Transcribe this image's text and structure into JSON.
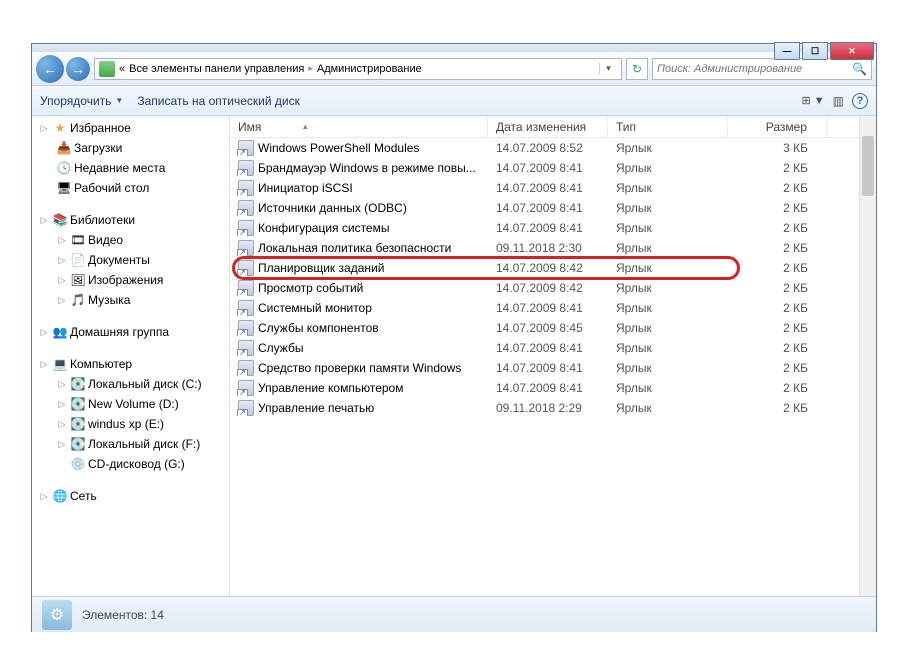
{
  "breadcrumb": {
    "prefix": "«",
    "parent": "Все элементы панели управления",
    "current": "Администрирование"
  },
  "search": {
    "placeholder": "Поиск: Администрирование"
  },
  "toolbar": {
    "organize": "Упорядочить",
    "burn": "Записать на оптический диск"
  },
  "sidebar": {
    "favorites": "Избранное",
    "downloads": "Загрузки",
    "recent": "Недавние места",
    "desktop": "Рабочий стол",
    "libraries": "Библиотеки",
    "videos": "Видео",
    "documents": "Документы",
    "pictures": "Изображения",
    "music": "Музыка",
    "homegroup": "Домашняя группа",
    "computer": "Компьютер",
    "disk_c": "Локальный диск (C:)",
    "disk_d": "New Volume (D:)",
    "disk_e": "windus xp (E:)",
    "disk_f": "Локальный диск (F:)",
    "cd": "CD-дисковод (G:)",
    "network": "Сеть"
  },
  "columns": {
    "name": "Имя",
    "date": "Дата изменения",
    "type": "Тип",
    "size": "Размер"
  },
  "type_label": "Ярлык",
  "files": [
    {
      "name": "Windows PowerShell Modules",
      "date": "14.07.2009 8:52",
      "size": "3 КБ"
    },
    {
      "name": "Брандмауэр Windows в режиме повы...",
      "date": "14.07.2009 8:41",
      "size": "2 КБ"
    },
    {
      "name": "Инициатор iSCSI",
      "date": "14.07.2009 8:41",
      "size": "2 КБ"
    },
    {
      "name": "Источники данных (ODBC)",
      "date": "14.07.2009 8:41",
      "size": "2 КБ"
    },
    {
      "name": "Конфигурация системы",
      "date": "14.07.2009 8:41",
      "size": "2 КБ"
    },
    {
      "name": "Локальная политика безопасности",
      "date": "09.11.2018 2:30",
      "size": "2 КБ"
    },
    {
      "name": "Планировщик заданий",
      "date": "14.07.2009 8:42",
      "size": "2 КБ",
      "highlight": true
    },
    {
      "name": "Просмотр событий",
      "date": "14.07.2009 8:42",
      "size": "2 КБ"
    },
    {
      "name": "Системный монитор",
      "date": "14.07.2009 8:41",
      "size": "2 КБ"
    },
    {
      "name": "Службы компонентов",
      "date": "14.07.2009 8:45",
      "size": "2 КБ"
    },
    {
      "name": "Службы",
      "date": "14.07.2009 8:41",
      "size": "2 КБ"
    },
    {
      "name": "Средство проверки памяти Windows",
      "date": "14.07.2009 8:41",
      "size": "2 КБ"
    },
    {
      "name": "Управление компьютером",
      "date": "14.07.2009 8:41",
      "size": "2 КБ"
    },
    {
      "name": "Управление печатью",
      "date": "09.11.2018 2:29",
      "size": "2 КБ"
    }
  ],
  "status": {
    "label": "Элементов: 14"
  }
}
